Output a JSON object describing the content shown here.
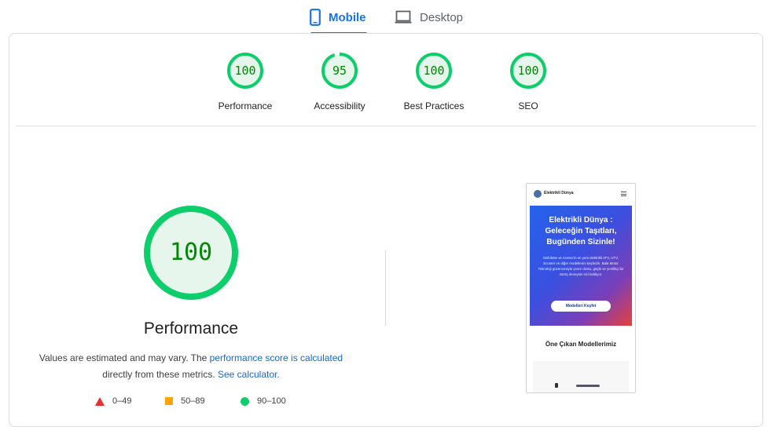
{
  "tabs": [
    {
      "label": "Mobile",
      "icon": "smartphone-icon",
      "active": true
    },
    {
      "label": "Desktop",
      "icon": "laptop-icon",
      "active": false
    }
  ],
  "colors": {
    "pass": "#0cce6b",
    "pass_text": "#008800",
    "pass_fill": "#e6f6ec",
    "average": "#ffa400",
    "fail": "#e8312f",
    "accent": "#1a73e8"
  },
  "categories": [
    {
      "score": "100",
      "label": "Performance",
      "value": 100
    },
    {
      "score": "95",
      "label": "Accessibility",
      "value": 95
    },
    {
      "score": "100",
      "label": "Best Practices",
      "value": 100
    },
    {
      "score": "100",
      "label": "SEO",
      "value": 100
    }
  ],
  "main": {
    "score": "100",
    "value": 100,
    "title": "Performance",
    "desc_prefix": "Values are estimated and may vary. The ",
    "desc_link1": "performance score is calculated",
    "desc_mid": " directly from these metrics. ",
    "desc_link2": "See calculator."
  },
  "legend": [
    {
      "range": "0–49",
      "shape": "triangle"
    },
    {
      "range": "50–89",
      "shape": "square"
    },
    {
      "range": "90–100",
      "shape": "circle"
    }
  ],
  "screenshot": {
    "brand": "Elektrikli Dünya",
    "hero_title": "Elektrikli Dünya : Geleceğin Taşıtları, Bugünden Sizinle!",
    "hero_text": "Mobilette ve Acetec'in en yeni elektrikli ATV, UTV, Scooter ve diğer modellerini keşfedin. Bala Motor Teknoloji güvencesiyle çevre dostu, güçlü ve yenilikçi bir sürüş deneyimi sizi bekliyor.",
    "hero_button": "Modelleri Keşfet",
    "section_title": "Öne Çıkan Modellerimiz"
  }
}
